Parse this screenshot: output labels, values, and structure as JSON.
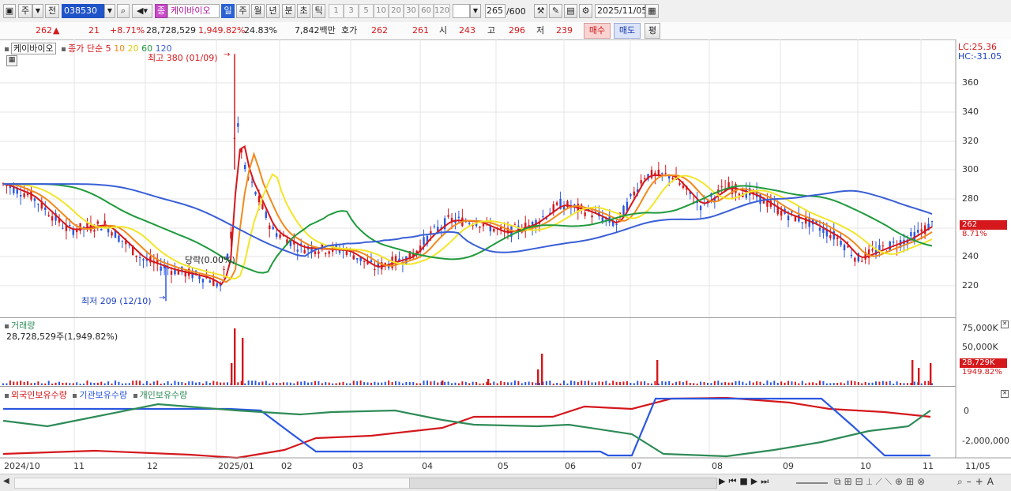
{
  "toolbar": {
    "market": "주",
    "prefix": "전",
    "code": "038530",
    "badge": "종",
    "name": "케이바이오",
    "periods": [
      "일",
      "주",
      "월",
      "년",
      "분",
      "초",
      "틱"
    ],
    "active_period": "일",
    "numbers": [
      "1",
      "3",
      "5",
      "10",
      "20",
      "30",
      "60",
      "120"
    ],
    "count_value": "265",
    "count_total": "/600",
    "date": "2025/11/05"
  },
  "quote": {
    "price": "262",
    "change": "21",
    "rate": "+8.71%",
    "volume": "28,728,529",
    "vol_rate": "1,949.82%",
    "turnover": "24.83%",
    "amount": "7,842백만",
    "hoga_label": "호가",
    "ask": "262",
    "bid": "261",
    "open_label": "시",
    "open": "243",
    "high_label": "고",
    "high": "296",
    "low_label": "저",
    "low": "239",
    "buy": "매수",
    "sell": "매도",
    "avg": "평"
  },
  "colors": {
    "red": "#d4181c",
    "blue": "#2b57e0",
    "orange": "#f08a1c",
    "yellow": "#f2e62a",
    "green": "#1f9a3c",
    "teal": "#2e8b57",
    "ma120": "#3a5fd6"
  },
  "price_panel": {
    "title": "케이바이오",
    "ma_label": "종가 단순",
    "ma": [
      "5",
      "10",
      "20",
      "60",
      "120"
    ],
    "lc": "LC:25.36",
    "hc": "HC:-31.05",
    "high_note": "최고 380 (01/09)",
    "low_note": "최저 209 (12/10)",
    "mid_note": "당락(0.00%)",
    "y_ticks": [
      "360",
      "340",
      "320",
      "300",
      "280",
      "260",
      "240",
      "220"
    ],
    "last_price": "262",
    "last_rate": "8.71%"
  },
  "volume_panel": {
    "title": "거래량",
    "value": "28,728,529주(1,949.82%)",
    "y_ticks": [
      "75,000K",
      "50,000K"
    ],
    "last_value": "28,729K",
    "last_rate": "1949.82%"
  },
  "holding_panel": {
    "series": [
      "외국인보유수량",
      "기관보유수량",
      "개인보유수량"
    ],
    "y_ticks": [
      "0",
      "-2,000,000"
    ]
  },
  "dates": [
    "2024/10",
    "11",
    "12",
    "2025/01",
    "02",
    "03",
    "04",
    "05",
    "06",
    "07",
    "08",
    "09",
    "10",
    "11",
    "11/05"
  ]
}
